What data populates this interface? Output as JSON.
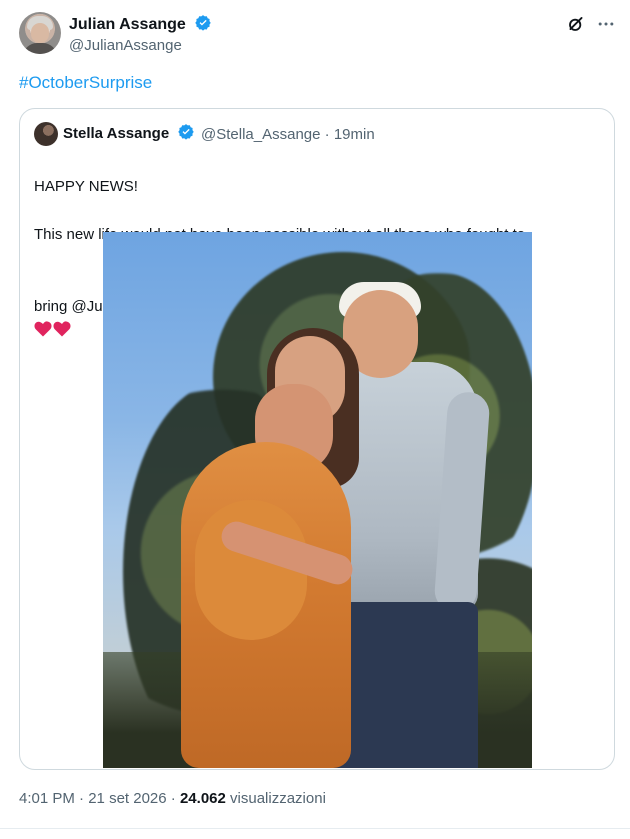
{
  "tweet": {
    "author_name": "Julian Assange",
    "author_handle": "@JulianAssange",
    "text": "#OctoberSurprise"
  },
  "quoted_tweet": {
    "author_name": "Stella Assange",
    "author_handle": "@Stella_Assange",
    "separator": "·",
    "time_ago": "19min",
    "text_lines": [
      "HAPPY NEWS!",
      "This new life would not have been possible without all those who fought to",
      "bring @JulianAssange home"
    ]
  },
  "meta": {
    "time": "4:01 PM",
    "date": "21 set 2026",
    "views": "24.062",
    "views_label": "visualizzazioni",
    "separator": "·"
  },
  "colors": {
    "text": "#0f1419",
    "muted": "#536471",
    "accent": "#1d9bf0",
    "heart": "#e0245e",
    "border": "#cfd9de"
  },
  "icons": {
    "verified": "verified-badge-icon",
    "grok": "grok-icon",
    "more": "more-icon",
    "heart": "red-heart-icon"
  }
}
